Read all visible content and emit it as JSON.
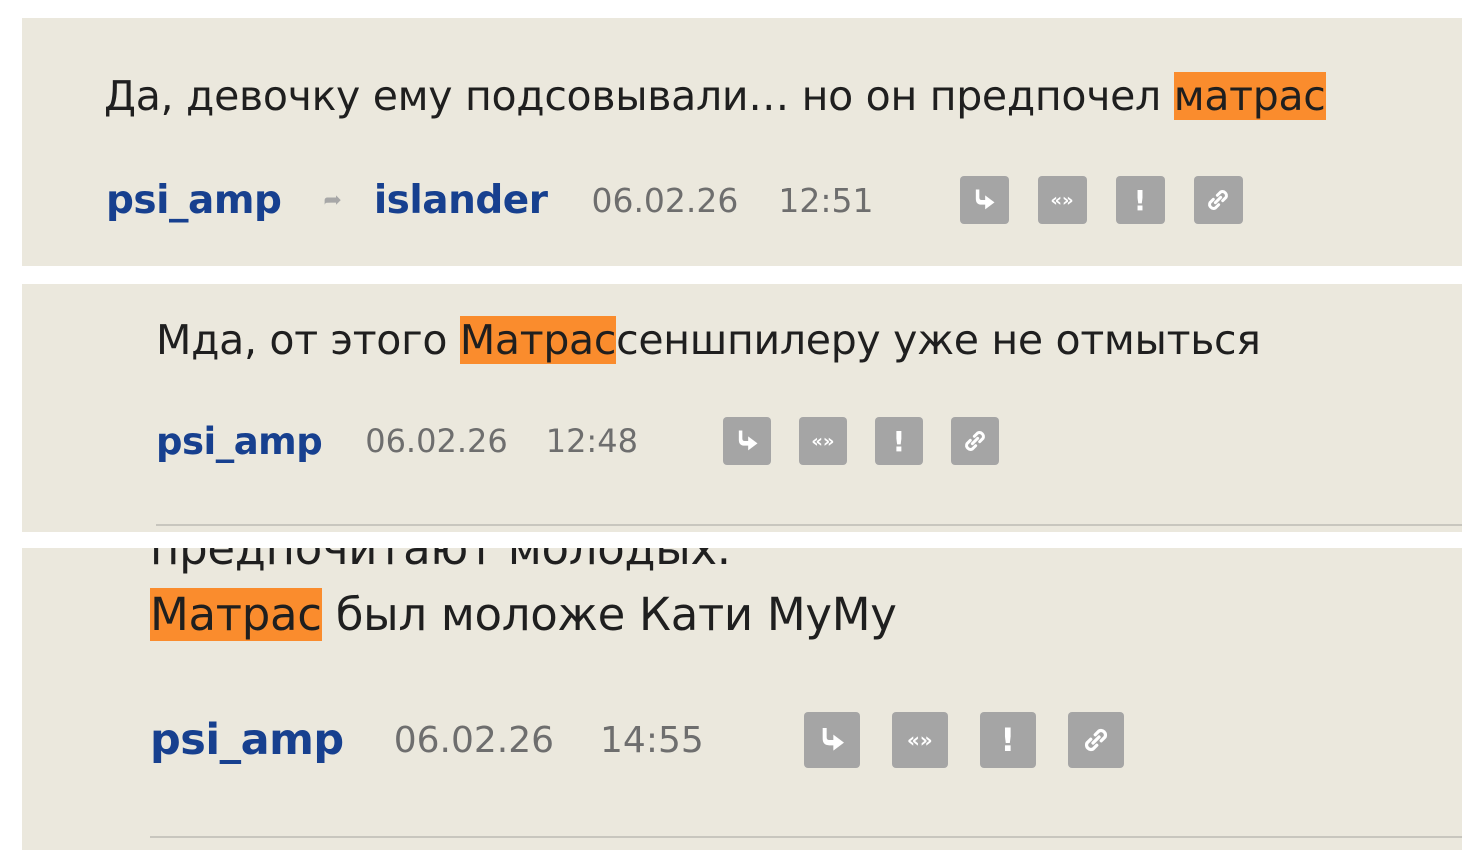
{
  "comments": [
    {
      "text_before": "Да, девочку ему подсовывали… но он предпочел ",
      "highlight": "матрас",
      "text_after": "",
      "author": "psi_amp",
      "reply_to": "islander",
      "date": "06.02.26",
      "time": "12:51"
    },
    {
      "text_before": "Мда, от этого ",
      "highlight": "Матрас",
      "text_after": "сеншпилеру уже не отмыться",
      "author": "psi_amp",
      "date": "06.02.26",
      "time": "12:48"
    },
    {
      "cut_line": "предпочитают молодых.",
      "text_before": "",
      "highlight": "Матрас",
      "text_after": " был моложе Кати МуМу",
      "author": "psi_amp",
      "date": "06.02.26",
      "time": "14:55"
    }
  ],
  "action_icons": {
    "reply": "reply-arrow-icon",
    "quote": "quote-icon",
    "quote_label": "«»",
    "report": "exclamation-icon",
    "report_label": "!",
    "link": "chain-link-icon"
  },
  "colors": {
    "panel_bg": "#ebe8dd",
    "highlight": "#fa8c2d",
    "author": "#17408f",
    "muted_text": "#6e6e6e",
    "icon_bg": "#a5a5a5"
  }
}
